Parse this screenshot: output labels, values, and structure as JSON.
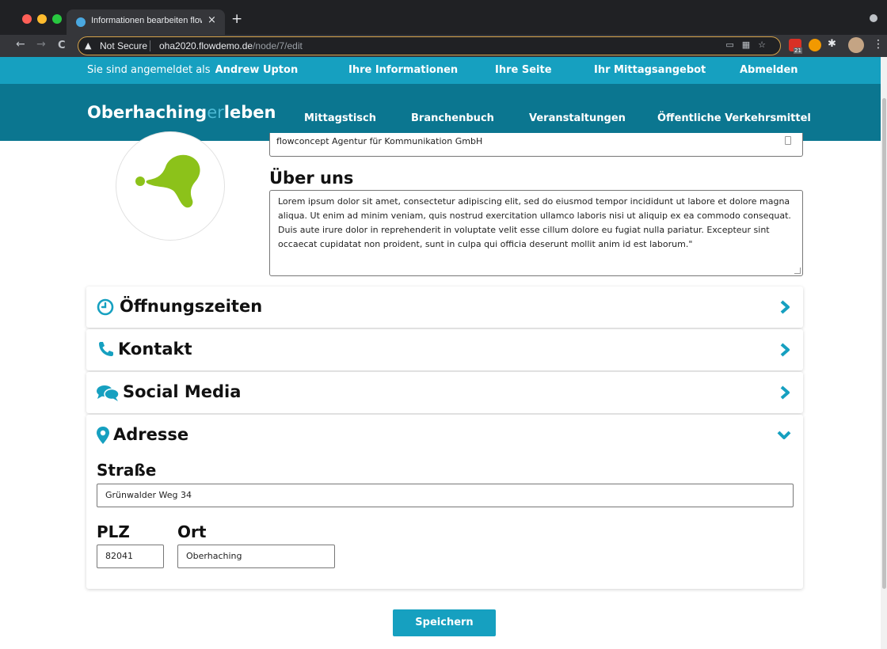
{
  "browser": {
    "tab_title": "Informationen bearbeiten flowc",
    "tab_close": "×",
    "new_tab": "+",
    "security_label": "Not Secure",
    "url_host": "oha2020.flowdemo.de",
    "url_path": "/node/7/edit",
    "calendar_badge": "21",
    "icons": {
      "back": "arrow-left-icon",
      "forward": "arrow-right-icon",
      "reload": "reload-icon",
      "warning": "warning-triangle-icon",
      "bookmark": "star-icon",
      "extensions": "puzzle-icon",
      "menu": "kebab-menu-icon"
    }
  },
  "topbar": {
    "logged_in_prefix": "Sie sind angemeldet als",
    "user_name": "Andrew Upton",
    "links": [
      "Ihre Informationen",
      "Ihre Seite",
      "Ihr Mittagsangebot",
      "Abmelden"
    ]
  },
  "mainnav": {
    "logo_part1": "Oberhaching",
    "logo_part2": "er",
    "logo_part3": "leben",
    "items": [
      "Mittagstisch",
      "Branchenbuch",
      "Veranstaltungen",
      "Öffentliche Verkehrsmittel"
    ]
  },
  "profile": {
    "company_name": "flowconcept Agentur für Kommunikation GmbH",
    "about_label": "Über uns",
    "about_text": "Lorem ipsum dolor sit amet, consectetur adipiscing elit, sed do eiusmod tempor incididunt ut labore et dolore magna aliqua. Ut enim ad minim veniam, quis nostrud exercitation ullamco laboris nisi ut aliquip ex ea commodo consequat. Duis aute irure dolor in reprehenderit in voluptate velit esse cillum dolore eu fugiat nulla pariatur. Excepteur sint occaecat cupidatat non proident, sunt in culpa qui officia deserunt mollit anim id est laborum.\""
  },
  "sections": {
    "oeffnungszeiten": "Öffnungszeiten",
    "kontakt": "Kontakt",
    "social_media": "Social Media",
    "adresse": "Adresse"
  },
  "address": {
    "street_label": "Straße",
    "street_value": "Grünwalder Weg 34",
    "plz_label": "PLZ",
    "plz_value": "82041",
    "ort_label": "Ort",
    "ort_value": "Oberhaching"
  },
  "save_label": "Speichern",
  "colors": {
    "accent": "#16a0c0",
    "nav_bg": "#0b7690",
    "logo_highlight": "#4cb9d4",
    "avatar_green": "#8cc21a"
  }
}
